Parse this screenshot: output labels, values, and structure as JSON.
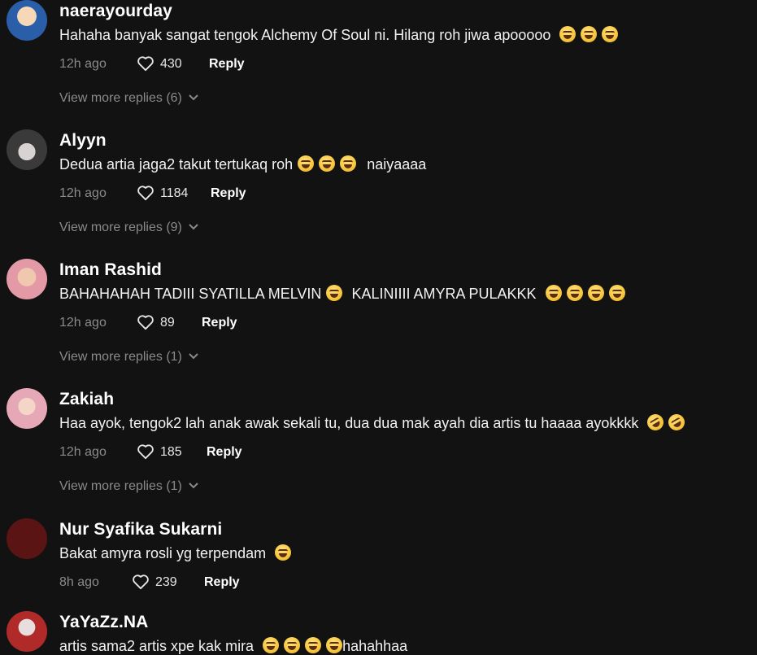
{
  "comments": [
    {
      "username": "naerayourday",
      "text": "Hahaha banyak sangat tengok Alchemy Of Soul ni. Hilang roh jiwa apooooo",
      "emoji_count": 3,
      "emoji_type": "laugh",
      "time": "12h ago",
      "likes": "430",
      "reply": "Reply",
      "more": "View more replies (6)",
      "avatar_color": "#2a5ea8"
    },
    {
      "username": "Alyyn",
      "text": "Dedua artia jaga2 takut tertukaq roh",
      "text_after": "naiyaaaa",
      "emoji_count": 3,
      "emoji_type": "laugh",
      "time": "12h ago",
      "likes": "1184",
      "reply": "Reply",
      "more": "View more replies (9)",
      "avatar_color": "#b8b0b0"
    },
    {
      "username": "Iman Rashid",
      "text": "BAHAHAHAH TADIII SYATILLA MELVIN",
      "text_mid": "KALINIIII AMYRA PULAKKK",
      "emoji_count": 4,
      "emoji_type": "laugh",
      "time": "12h ago",
      "likes": "89",
      "reply": "Reply",
      "more": "View more replies (1)",
      "avatar_color": "#c98a8a"
    },
    {
      "username": "Zakiah",
      "text": "Haa ayok, tengok2 lah anak awak sekali tu, dua dua mak ayah dia artis tu haaaa ayokkkk",
      "emoji_count": 2,
      "emoji_type": "rofl",
      "time": "12h ago",
      "likes": "185",
      "reply": "Reply",
      "more": "View more replies (1)",
      "avatar_color": "#d9a0a8"
    },
    {
      "username": "Nur Syafika Sukarni",
      "text": "Bakat amyra rosli yg terpendam",
      "emoji_count": 1,
      "emoji_type": "laugh",
      "time": "8h ago",
      "likes": "239",
      "reply": "Reply",
      "avatar_color": "#5a1414"
    },
    {
      "username": "YaYaZz.NA",
      "text": "artis sama2 artis xpe kak mira",
      "text_after": "hahahhaa",
      "emoji_count": 4,
      "emoji_type": "laugh",
      "avatar_color": "#b02a2a"
    }
  ],
  "icons": {
    "like": "heart-outline-icon",
    "expand": "chevron-down-icon"
  }
}
